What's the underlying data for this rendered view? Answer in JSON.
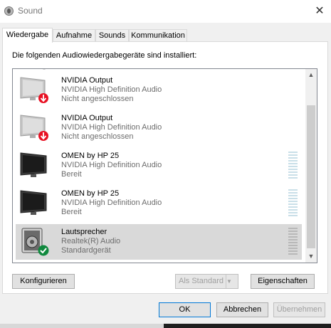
{
  "window": {
    "title": "Sound"
  },
  "tabs": [
    {
      "label": "Wiedergabe",
      "active": true
    },
    {
      "label": "Aufnahme"
    },
    {
      "label": "Sounds"
    },
    {
      "label": "Kommunikation"
    }
  ],
  "playback": {
    "intro": "Die folgenden Audiowiedergabegeräte sind installiert:",
    "devices": [
      {
        "name": "NVIDIA Output",
        "description": "NVIDIA High Definition Audio",
        "status": "Nicht angeschlossen",
        "icon": "monitor-disconnected-icon"
      },
      {
        "name": "NVIDIA Output",
        "description": "NVIDIA High Definition Audio",
        "status": "Nicht angeschlossen",
        "icon": "monitor-disconnected-icon"
      },
      {
        "name": "OMEN by HP 25",
        "description": "NVIDIA High Definition Audio",
        "status": "Bereit",
        "icon": "monitor-icon"
      },
      {
        "name": "OMEN by HP 25",
        "description": "NVIDIA High Definition Audio",
        "status": "Bereit",
        "icon": "monitor-icon"
      },
      {
        "name": "Lautsprecher",
        "description": "Realtek(R) Audio",
        "status": "Standardgerät",
        "icon": "speaker-default-icon",
        "selected": true
      }
    ],
    "buttons": {
      "configure": "Konfigurieren",
      "set_default": "Als Standard",
      "properties": "Eigenschaften"
    }
  },
  "footer": {
    "ok": "OK",
    "cancel": "Abbrechen",
    "apply": "Übernehmen"
  },
  "colors": {
    "accent": "#0078d7",
    "error": "#e81123",
    "success": "#10893e",
    "selection": "#d9d9d9"
  }
}
